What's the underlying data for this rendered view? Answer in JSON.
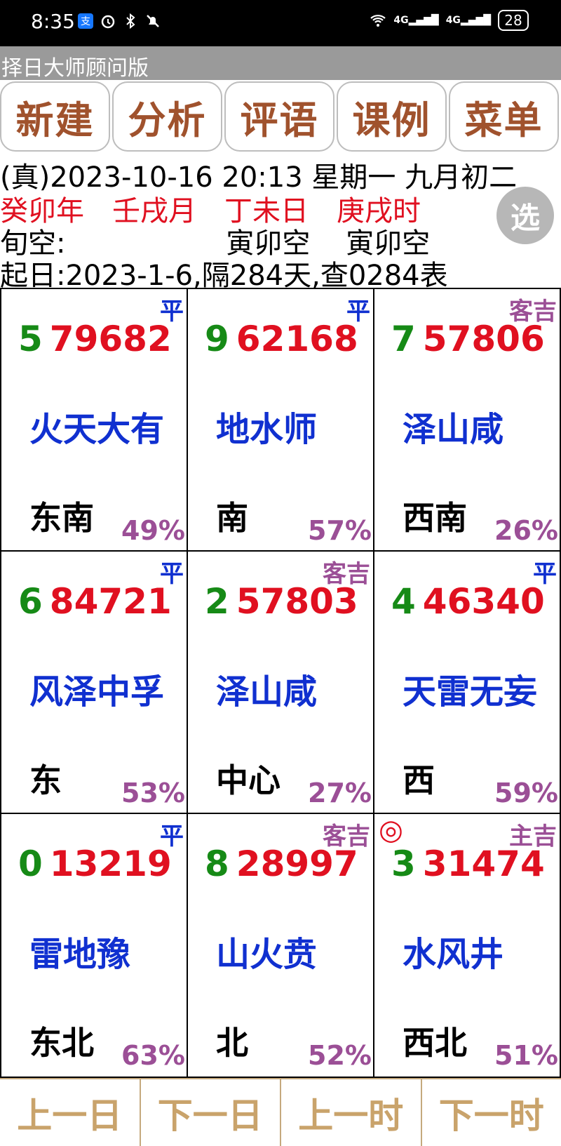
{
  "status": {
    "time": "8:35",
    "battery": "28",
    "net1": "4G",
    "net2": "4G"
  },
  "app": {
    "title": "择日大师顾问版"
  },
  "toolbar": {
    "new": "新建",
    "analyze": "分析",
    "comment": "评语",
    "cases": "课例",
    "menu": "菜单"
  },
  "info": {
    "line1": "(真)2023-10-16 20:13 星期一 九月初二",
    "ganzhi": "癸卯年　壬戌月　丁未日　庚戌时",
    "xunkong": "旬空:                  寅卯空    寅卯空",
    "start": "起日:2023-1-6,隔284天,查0284表",
    "select_label": "选"
  },
  "cells": [
    {
      "tag": "平",
      "n1": "5",
      "n2": "79682",
      "hex": "火天大有",
      "dir": "东南",
      "pct": "49%"
    },
    {
      "tag": "平",
      "n1": "9",
      "n2": "62168",
      "hex": "地水师",
      "dir": "南",
      "pct": "57%"
    },
    {
      "tag": "客吉",
      "n1": "7",
      "n2": "57806",
      "hex": "泽山咸",
      "dir": "西南",
      "pct": "26%"
    },
    {
      "tag": "平",
      "n1": "6",
      "n2": "84721",
      "hex": "风泽中孚",
      "dir": "东",
      "pct": "53%"
    },
    {
      "tag": "客吉",
      "n1": "2",
      "n2": "57803",
      "hex": "泽山咸",
      "dir": "中心",
      "pct": "27%"
    },
    {
      "tag": "平",
      "n1": "4",
      "n2": "46340",
      "hex": "天雷无妄",
      "dir": "西",
      "pct": "59%"
    },
    {
      "tag": "平",
      "n1": "0",
      "n2": "13219",
      "hex": "雷地豫",
      "dir": "东北",
      "pct": "63%"
    },
    {
      "tag": "客吉",
      "n1": "8",
      "n2": "28997",
      "hex": "山火贲",
      "dir": "北",
      "pct": "52%"
    },
    {
      "tag": "主吉",
      "n1": "3",
      "n2": "31474",
      "hex": "水风井",
      "dir": "西北",
      "pct": "51%",
      "mark": "◎"
    }
  ],
  "nav": {
    "prev_day": "上一日",
    "next_day": "下一日",
    "prev_hour": "上一时",
    "next_hour": "下一时"
  },
  "colors": {
    "brown": "#a0522d",
    "red": "#e01020",
    "green": "#168a16",
    "blue": "#1030d0",
    "purple": "#9b4f96",
    "gold": "#c9a36b"
  }
}
